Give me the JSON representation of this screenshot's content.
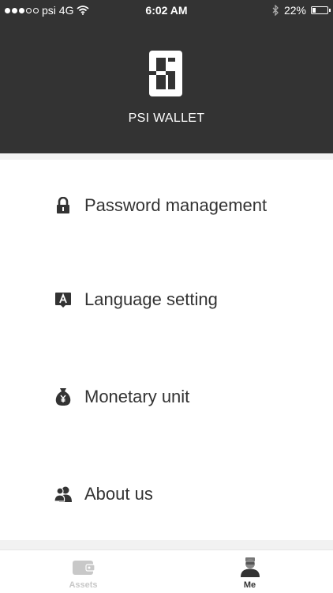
{
  "status_bar": {
    "carrier": "psi 4G",
    "signal_bars_filled": 3,
    "signal_bars_total": 5,
    "time": "6:02 AM",
    "battery_percent": "22%",
    "battery_level": 0.22
  },
  "header": {
    "app_name": "PSI WALLET",
    "background_color": "#333333"
  },
  "menu": {
    "items": [
      {
        "label": "Password management",
        "icon": "lock-icon"
      },
      {
        "label": "Language setting",
        "icon": "language-icon"
      },
      {
        "label": "Monetary unit",
        "icon": "money-bag-icon"
      },
      {
        "label": "About us",
        "icon": "users-icon"
      }
    ]
  },
  "tabbar": {
    "tabs": [
      {
        "label": "Assets",
        "icon": "wallet-icon",
        "active": false,
        "color": "#c8c8c8"
      },
      {
        "label": "Me",
        "icon": "person-icon",
        "active": true,
        "color": "#333333"
      }
    ]
  }
}
